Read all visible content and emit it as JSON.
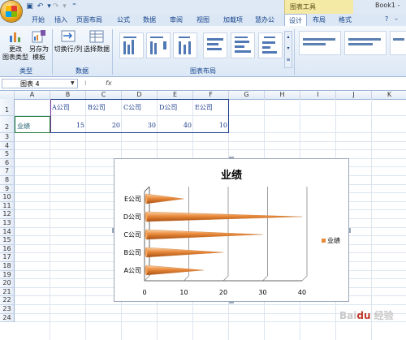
{
  "titlebar": {
    "book_title": "Book1 -",
    "contextual_tab": "图表工具"
  },
  "tabs": [
    {
      "label": "开始"
    },
    {
      "label": "插入"
    },
    {
      "label": "页面布局"
    },
    {
      "label": "公式"
    },
    {
      "label": "数据"
    },
    {
      "label": "审阅"
    },
    {
      "label": "视图"
    },
    {
      "label": "加载项"
    },
    {
      "label": "慧办公"
    },
    {
      "label": "设计"
    },
    {
      "label": "布局"
    },
    {
      "label": "格式"
    }
  ],
  "active_tab": "设计",
  "ribbon": {
    "type_group": {
      "label": "类型",
      "change_type_line1": "更改",
      "change_type_line2": "图表类型",
      "save_template_line1": "另存为",
      "save_template_line2": "模板"
    },
    "data_group": {
      "label": "数据",
      "switch_row_col": "切换行/列",
      "select_data": "选择数据"
    },
    "layout_group": {
      "label": "图表布局"
    }
  },
  "formula_bar": {
    "name_box": "图表 4",
    "fx": "fx",
    "value": ""
  },
  "columns": [
    "A",
    "B",
    "C",
    "D",
    "E",
    "F",
    "G",
    "H",
    "I",
    "J",
    "K"
  ],
  "rows": [
    "1",
    "2",
    "3",
    "4",
    "5",
    "6",
    "7",
    "8",
    "9",
    "10",
    "11",
    "12",
    "13",
    "14",
    "15",
    "16",
    "17",
    "18",
    "19",
    "20",
    "21",
    "22",
    "23",
    "24"
  ],
  "sheet": {
    "headers": [
      "A公司",
      "B公司",
      "C公司",
      "D公司",
      "E公司"
    ],
    "row_label": "业绩",
    "values": [
      "15",
      "20",
      "30",
      "40",
      "10"
    ]
  },
  "chart_data": {
    "type": "bar",
    "title": "业绩",
    "categories": [
      "A公司",
      "B公司",
      "C公司",
      "D公司",
      "E公司"
    ],
    "series": [
      {
        "name": "业绩",
        "values": [
          15,
          20,
          30,
          40,
          10
        ]
      }
    ],
    "xlim": [
      0,
      40
    ],
    "xticks": [
      "0",
      "10",
      "20",
      "30",
      "40"
    ],
    "grid": true,
    "legend": "right",
    "bar_color": "#e9893a"
  },
  "watermark": "Baidu 经验"
}
